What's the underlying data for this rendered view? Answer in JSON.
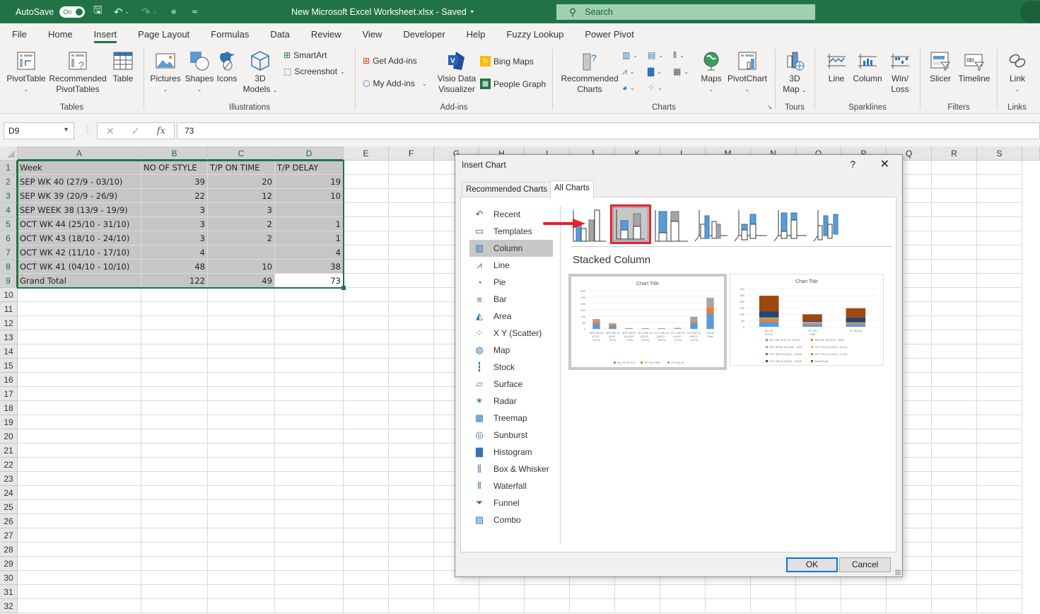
{
  "titlebar": {
    "autosave_label": "AutoSave",
    "autosave_state": "On",
    "document_title": "New Microsoft Excel Worksheet.xlsx  -  Saved",
    "search_placeholder": "Search"
  },
  "menu": {
    "tabs": [
      "File",
      "Home",
      "Insert",
      "Page Layout",
      "Formulas",
      "Data",
      "Review",
      "View",
      "Developer",
      "Help",
      "Fuzzy Lookup",
      "Power Pivot"
    ],
    "active": "Insert"
  },
  "ribbon": {
    "groups": {
      "tables": "Tables",
      "illustrations": "Illustrations",
      "addins": "Add-ins",
      "charts": "Charts",
      "tours": "Tours",
      "sparklines": "Sparklines",
      "filters": "Filters",
      "links": "Links"
    },
    "buttons": {
      "pivottable": "PivotTable",
      "recommended_pivottables_1": "Recommended",
      "recommended_pivottables_2": "PivotTables",
      "table": "Table",
      "pictures": "Pictures",
      "shapes": "Shapes",
      "icons": "Icons",
      "models_1": "3D",
      "models_2": "Models",
      "smartart": "SmartArt",
      "screenshot": "Screenshot",
      "get_addins": "Get Add-ins",
      "my_addins": "My Add-ins",
      "visio_1": "Visio Data",
      "visio_2": "Visualizer",
      "bing_maps": "Bing Maps",
      "people_graph": "People Graph",
      "recommended_charts_1": "Recommended",
      "recommended_charts_2": "Charts",
      "maps": "Maps",
      "pivotchart": "PivotChart",
      "map3d_1": "3D",
      "map3d_2": "Map",
      "line": "Line",
      "column": "Column",
      "winloss_1": "Win/",
      "winloss_2": "Loss",
      "slicer": "Slicer",
      "timeline": "Timeline",
      "link": "Link"
    }
  },
  "formula_bar": {
    "name_box": "D9",
    "fx": "fx",
    "value": "73"
  },
  "sheet": {
    "columns": [
      "A",
      "B",
      "C",
      "D",
      "E",
      "F",
      "G",
      "H",
      "I",
      "J",
      "K",
      "L",
      "M",
      "N",
      "O",
      "P",
      "Q",
      "R",
      "S"
    ],
    "rows": [
      "1",
      "2",
      "3",
      "4",
      "5",
      "6",
      "7",
      "8",
      "9",
      "10",
      "11",
      "12",
      "13",
      "14",
      "15",
      "16",
      "17",
      "18",
      "19",
      "20",
      "21",
      "22",
      "23",
      "24",
      "25",
      "26",
      "27",
      "28",
      "29",
      "30",
      "31",
      "32"
    ],
    "data": [
      [
        "Week",
        "NO OF STYLE",
        "T/P ON TIME",
        "T/P DELAY"
      ],
      [
        "SEP WK 40 (27/9 - 03/10)",
        "39",
        "20",
        "19"
      ],
      [
        "SEP WK 39 (20/9 - 26/9)",
        "22",
        "12",
        "10"
      ],
      [
        "SEP WEEK 38 (13/9 - 19/9)",
        "3",
        "3",
        ""
      ],
      [
        "OCT WK 44 (25/10 - 31/10)",
        "3",
        "2",
        "1"
      ],
      [
        "OCT WK 43 (18/10 - 24/10)",
        "3",
        "2",
        "1"
      ],
      [
        "OCT WK 42 (11/10 - 17/10)",
        "4",
        "",
        "4"
      ],
      [
        "OCT WK 41 (04/10 - 10/10)",
        "48",
        "10",
        "38"
      ],
      [
        "Grand Total",
        "122",
        "49",
        "73"
      ]
    ],
    "active_cell": "D9",
    "selection": "A1:D9"
  },
  "dialog": {
    "title": "Insert Chart",
    "help": "?",
    "close": "✕",
    "tabs": [
      "Recommended Charts",
      "All Charts"
    ],
    "active_tab": "All Charts",
    "chart_types": [
      "Recent",
      "Templates",
      "Column",
      "Line",
      "Pie",
      "Bar",
      "Area",
      "X Y (Scatter)",
      "Map",
      "Stock",
      "Surface",
      "Radar",
      "Treemap",
      "Sunburst",
      "Histogram",
      "Box & Whisker",
      "Waterfall",
      "Funnel",
      "Combo"
    ],
    "active_type": "Column",
    "subtypes": [
      "Clustered Column",
      "Stacked Column",
      "100% Stacked Column",
      "3-D Clustered Column",
      "3-D Stacked Column",
      "3-D 100% Stacked Column",
      "3-D Column"
    ],
    "selected_subtype_label": "Stacked Column",
    "ok": "OK",
    "cancel": "Cancel",
    "previews": [
      {
        "title": "Chart Title",
        "y_ticks": [
          "300",
          "250",
          "200",
          "150",
          "100",
          "50",
          "0"
        ],
        "categories": [
          "SEP WK 40 (27/9 - 03/10)",
          "SEP WK 39 (20/9 - 26/9)",
          "SEP WEEK 38 (13/9 - 19/9)",
          "OCT WK 44 (25/10 - 31/10)",
          "OCT WK 43 (18/10 - 24/10)",
          "OCT WK 42 (11/10 - 17/10)",
          "OCT WK 41 (04/10 - 10/10)",
          "Grand Total"
        ],
        "legend": [
          "NO OF STYLE",
          "T/P ON TIME",
          "T/P DELAY"
        ]
      },
      {
        "title": "Chart Title",
        "y_ticks": [
          "300",
          "250",
          "200",
          "150",
          "100",
          "50",
          "0"
        ],
        "categories": [
          "NO OF STYLE",
          "T/P ON TIME",
          "T/P DELAY"
        ],
        "legend": [
          "SEP WK 40 (27/9 - 03/10)",
          "SEP WK 39 (20/9 - 26/9)",
          "SEP WEEK 38 (13/9 - 19/9)",
          "OCT WK 44 (25/10 - 31/10)",
          "OCT WK 43 (18/10 - 24/10)",
          "OCT WK 42 (11/10 - 17/10)",
          "OCT WK 41 (04/10 - 10/10)",
          "Grand Total"
        ]
      }
    ],
    "series_colors": [
      "#5b9bd5",
      "#ed7d31",
      "#a5a5a5",
      "#ffc000",
      "#4472c4",
      "#70ad47",
      "#264478",
      "#9e480e"
    ]
  },
  "annotation": {
    "arrow_color": "#e8202a"
  }
}
